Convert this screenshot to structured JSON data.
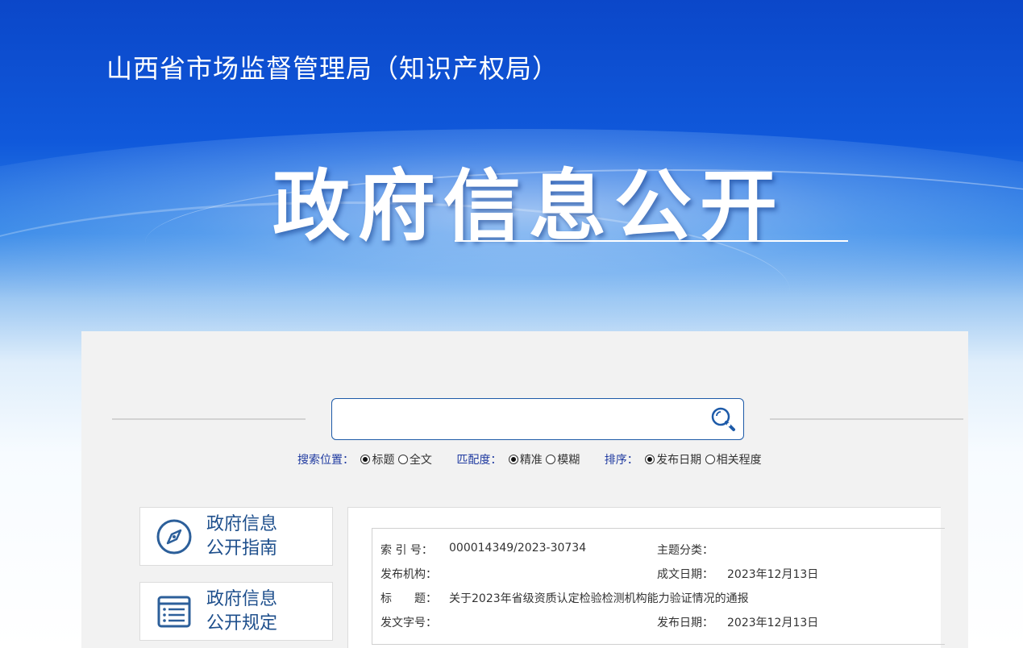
{
  "header": {
    "site_title": "山西省市场监督管理局（知识产权局）",
    "hero_title": "政府信息公开"
  },
  "search": {
    "placeholder": "",
    "value": "",
    "button_icon": "search-icon",
    "position_label": "搜索位置：",
    "position_options": [
      "标题",
      "全文"
    ],
    "position_selected": "标题",
    "match_label": "匹配度：",
    "match_options": [
      "精准",
      "模糊"
    ],
    "match_selected": "精准",
    "sort_label": "排序：",
    "sort_options": [
      "发布日期",
      "相关程度"
    ],
    "sort_selected": "发布日期"
  },
  "sidebar": {
    "items": [
      {
        "line1": "政府信息",
        "line2": "公开指南",
        "icon": "compass-icon"
      },
      {
        "line1": "政府信息",
        "line2": "公开规定",
        "icon": "document-list-icon"
      }
    ]
  },
  "document_info": {
    "index_label": "索 引 号：",
    "index_value": "000014349/2023-30734",
    "topic_label": "主题分类：",
    "topic_value": "",
    "publisher_label": "发布机构：",
    "publisher_value": "",
    "written_date_label": "成文日期：",
    "written_date_value": "2023年12月13日",
    "title_label": "标　　题：",
    "title_value": "关于2023年省级资质认定检验检测机构能力验证情况的通报",
    "doc_number_label": "发文字号：",
    "doc_number_value": "",
    "publish_date_label": "发布日期：",
    "publish_date_value": "2023年12月13日"
  },
  "colors": {
    "banner_blue": "#0b47c9",
    "link_blue": "#1f3aa0",
    "card_text": "#1e4f8c",
    "panel_bg": "#f2f2f2"
  }
}
